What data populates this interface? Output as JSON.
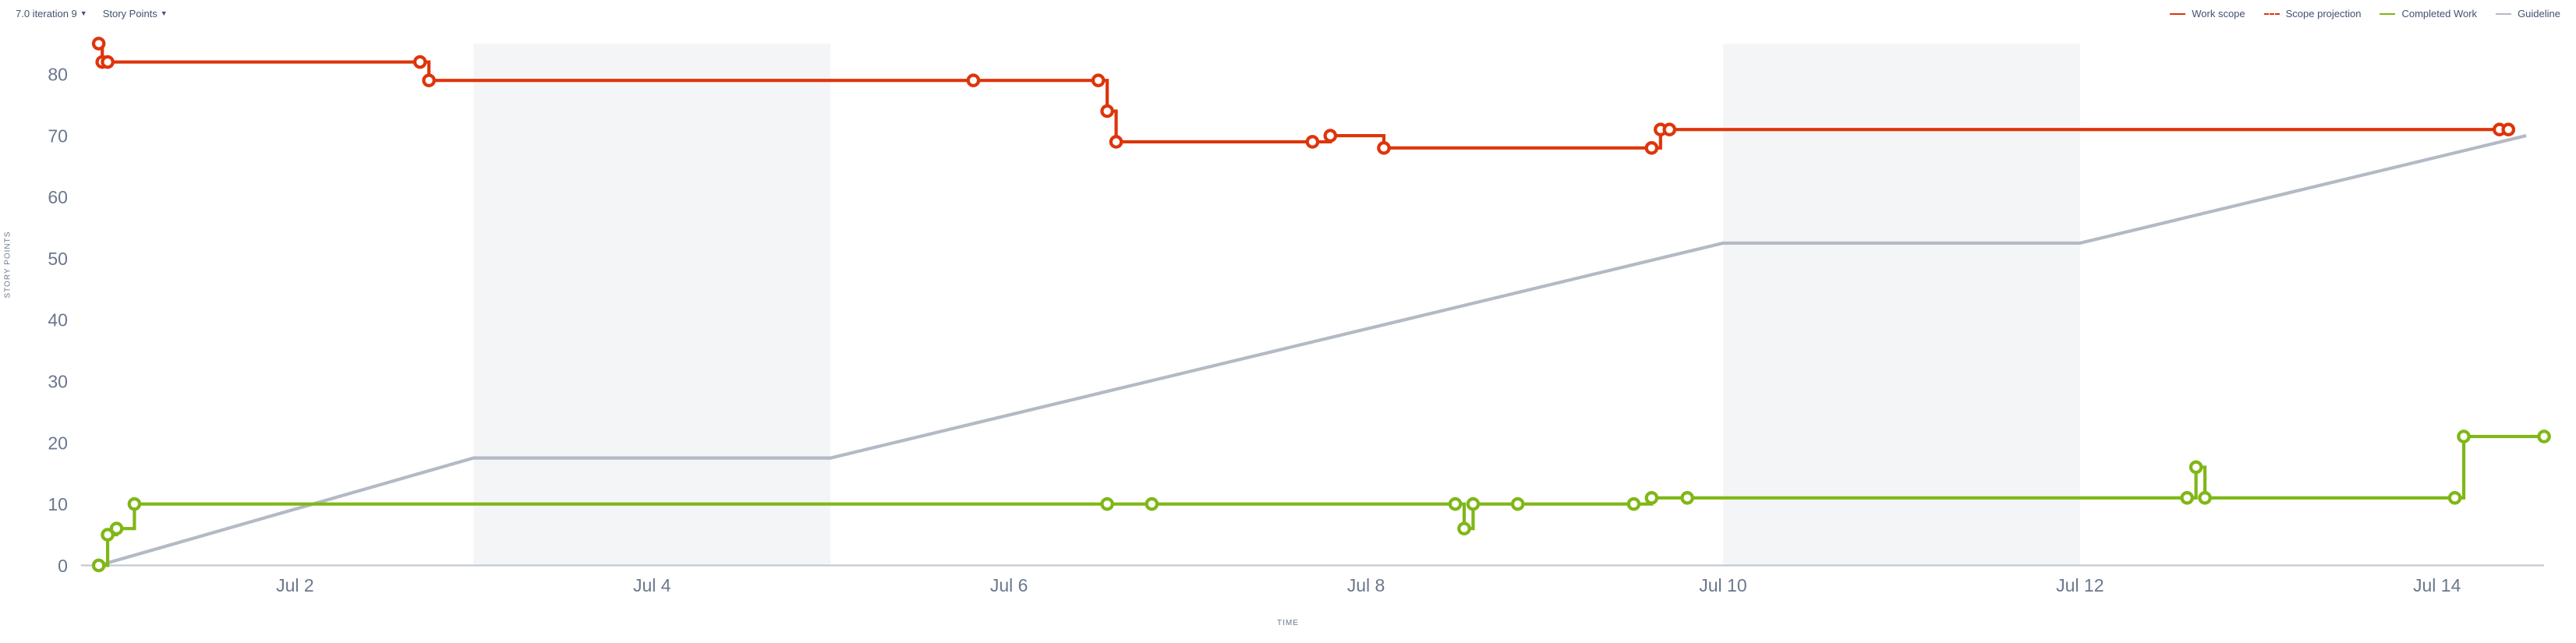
{
  "controls": {
    "iteration_label": "7.0 iteration 9",
    "metric_label": "Story Points"
  },
  "legend": {
    "work_scope": "Work scope",
    "scope_projection": "Scope projection",
    "completed_work": "Completed Work",
    "guideline": "Guideline"
  },
  "axes": {
    "y_label": "STORY POINTS",
    "x_label": "TIME"
  },
  "colors": {
    "work_scope": "#de350b",
    "scope_projection": "#de350b",
    "completed_work": "#7fb716",
    "guideline": "#b3bac5"
  },
  "chart_data": {
    "type": "line",
    "xlabel": "TIME",
    "ylabel": "STORY POINTS",
    "ylim": [
      0,
      85
    ],
    "x_ticks": [
      "Jul 2",
      "Jul 4",
      "Jul 6",
      "Jul 8",
      "Jul 10",
      "Jul 12",
      "Jul 14"
    ],
    "y_ticks": [
      0,
      10,
      20,
      30,
      40,
      50,
      60,
      70,
      80
    ],
    "x_domain_days": [
      0.8,
      14.6
    ],
    "weekend_bands_days": [
      [
        3,
        5
      ],
      [
        10,
        12
      ]
    ],
    "series": [
      {
        "name": "Guideline",
        "color": "#b3bac5",
        "style": "solid",
        "points": [
          {
            "x": 0.9,
            "y": 0
          },
          {
            "x": 3.0,
            "y": 17.5
          },
          {
            "x": 5.0,
            "y": 17.5
          },
          {
            "x": 10.0,
            "y": 52.5
          },
          {
            "x": 12.0,
            "y": 52.5
          },
          {
            "x": 14.5,
            "y": 70
          }
        ]
      },
      {
        "name": "Work scope",
        "color": "#de350b",
        "style": "solid",
        "markers": true,
        "points": [
          {
            "x": 0.9,
            "y": 85
          },
          {
            "x": 0.92,
            "y": 82
          },
          {
            "x": 0.95,
            "y": 82
          },
          {
            "x": 2.7,
            "y": 82
          },
          {
            "x": 2.75,
            "y": 79
          },
          {
            "x": 5.8,
            "y": 79
          },
          {
            "x": 6.5,
            "y": 79
          },
          {
            "x": 6.55,
            "y": 74
          },
          {
            "x": 6.6,
            "y": 69
          },
          {
            "x": 7.7,
            "y": 69
          },
          {
            "x": 7.8,
            "y": 70
          },
          {
            "x": 8.1,
            "y": 68
          },
          {
            "x": 9.6,
            "y": 68
          },
          {
            "x": 9.65,
            "y": 71
          },
          {
            "x": 9.7,
            "y": 71
          },
          {
            "x": 14.35,
            "y": 71
          },
          {
            "x": 14.4,
            "y": 71
          }
        ]
      },
      {
        "name": "Completed Work",
        "color": "#7fb716",
        "style": "solid",
        "markers": true,
        "points": [
          {
            "x": 0.9,
            "y": 0
          },
          {
            "x": 0.95,
            "y": 5
          },
          {
            "x": 1.0,
            "y": 6
          },
          {
            "x": 1.1,
            "y": 10
          },
          {
            "x": 6.55,
            "y": 10
          },
          {
            "x": 6.8,
            "y": 10
          },
          {
            "x": 8.5,
            "y": 10
          },
          {
            "x": 8.55,
            "y": 6
          },
          {
            "x": 8.6,
            "y": 10
          },
          {
            "x": 8.85,
            "y": 10
          },
          {
            "x": 9.5,
            "y": 10
          },
          {
            "x": 9.6,
            "y": 11
          },
          {
            "x": 9.8,
            "y": 11
          },
          {
            "x": 12.6,
            "y": 11
          },
          {
            "x": 12.65,
            "y": 16
          },
          {
            "x": 12.7,
            "y": 11
          },
          {
            "x": 14.1,
            "y": 11
          },
          {
            "x": 14.15,
            "y": 21
          },
          {
            "x": 14.6,
            "y": 21
          }
        ]
      }
    ]
  }
}
